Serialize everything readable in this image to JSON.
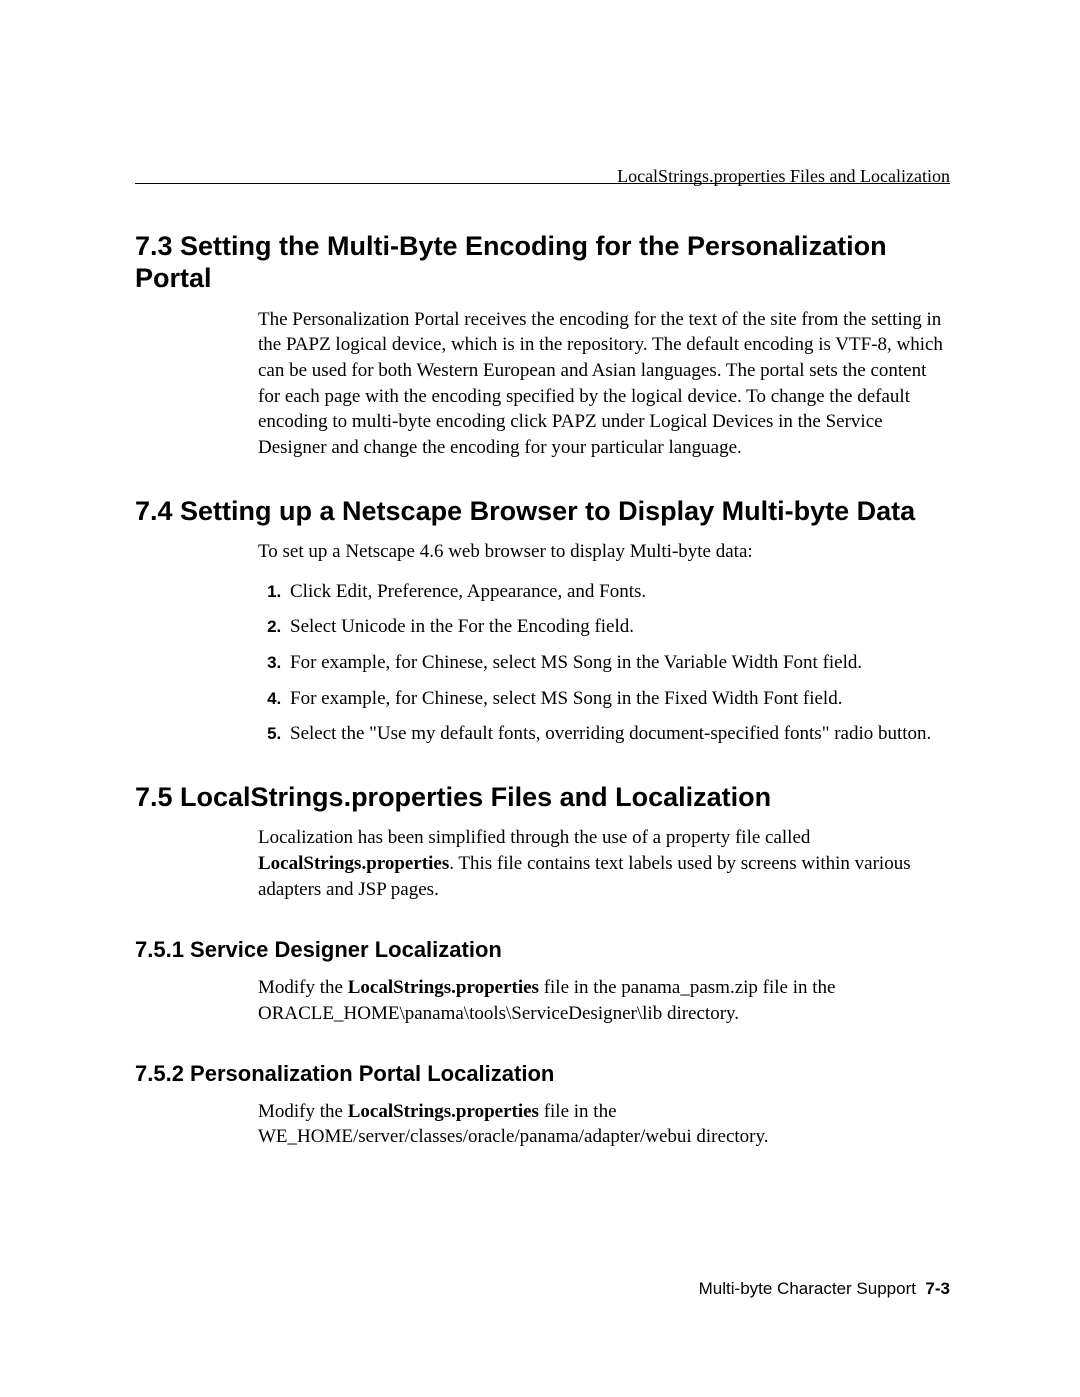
{
  "header": "LocalStrings.properties Files and Localization",
  "sections": {
    "s73": {
      "title": "7.3  Setting the Multi-Byte Encoding for the Personalization Portal",
      "body": "The Personalization Portal receives the encoding for the text of the site from the setting in the PAPZ logical device, which is in the repository. The default encoding is VTF-8, which can be used for both Western European and Asian languages. The portal sets the content for each page with the encoding specified by the logical device. To change the default encoding to multi-byte encoding click PAPZ under Logical Devices in the Service Designer and change the encoding for your particular language."
    },
    "s74": {
      "title": "7.4  Setting up a Netscape Browser to Display Multi-byte Data",
      "intro": "To set up a Netscape 4.6 web browser to display Multi-byte data:",
      "steps": [
        "Click Edit, Preference, Appearance, and Fonts.",
        "Select Unicode in the For the Encoding field.",
        "For example, for Chinese, select MS Song in the Variable Width Font field.",
        "For example, for Chinese, select MS Song in the Fixed Width Font field.",
        "Select the \"Use my default fonts, overriding document-specified fonts\" radio button."
      ]
    },
    "s75": {
      "title": "7.5  LocalStrings.properties Files and Localization",
      "body_pre": "Localization has been simplified through the use of a property file called ",
      "body_bold": "LocalStrings.properties",
      "body_post": ". This file contains text labels used by screens within various adapters and JSP pages."
    },
    "s751": {
      "title": "7.5.1  Service Designer Localization",
      "body_pre": "Modify the ",
      "body_bold": "LocalStrings.properties",
      "body_post": " file in the panama_pasm.zip file in the ORACLE_HOME\\panama\\tools\\ServiceDesigner\\lib directory."
    },
    "s752": {
      "title": "7.5.2  Personalization Portal Localization",
      "body_pre": "Modify the ",
      "body_bold": "LocalStrings.properties",
      "body_post": " file in the WE_HOME/server/classes/oracle/panama/adapter/webui directory."
    }
  },
  "footer": {
    "chapter": "Multi-byte Character Support",
    "page": "7-3"
  }
}
